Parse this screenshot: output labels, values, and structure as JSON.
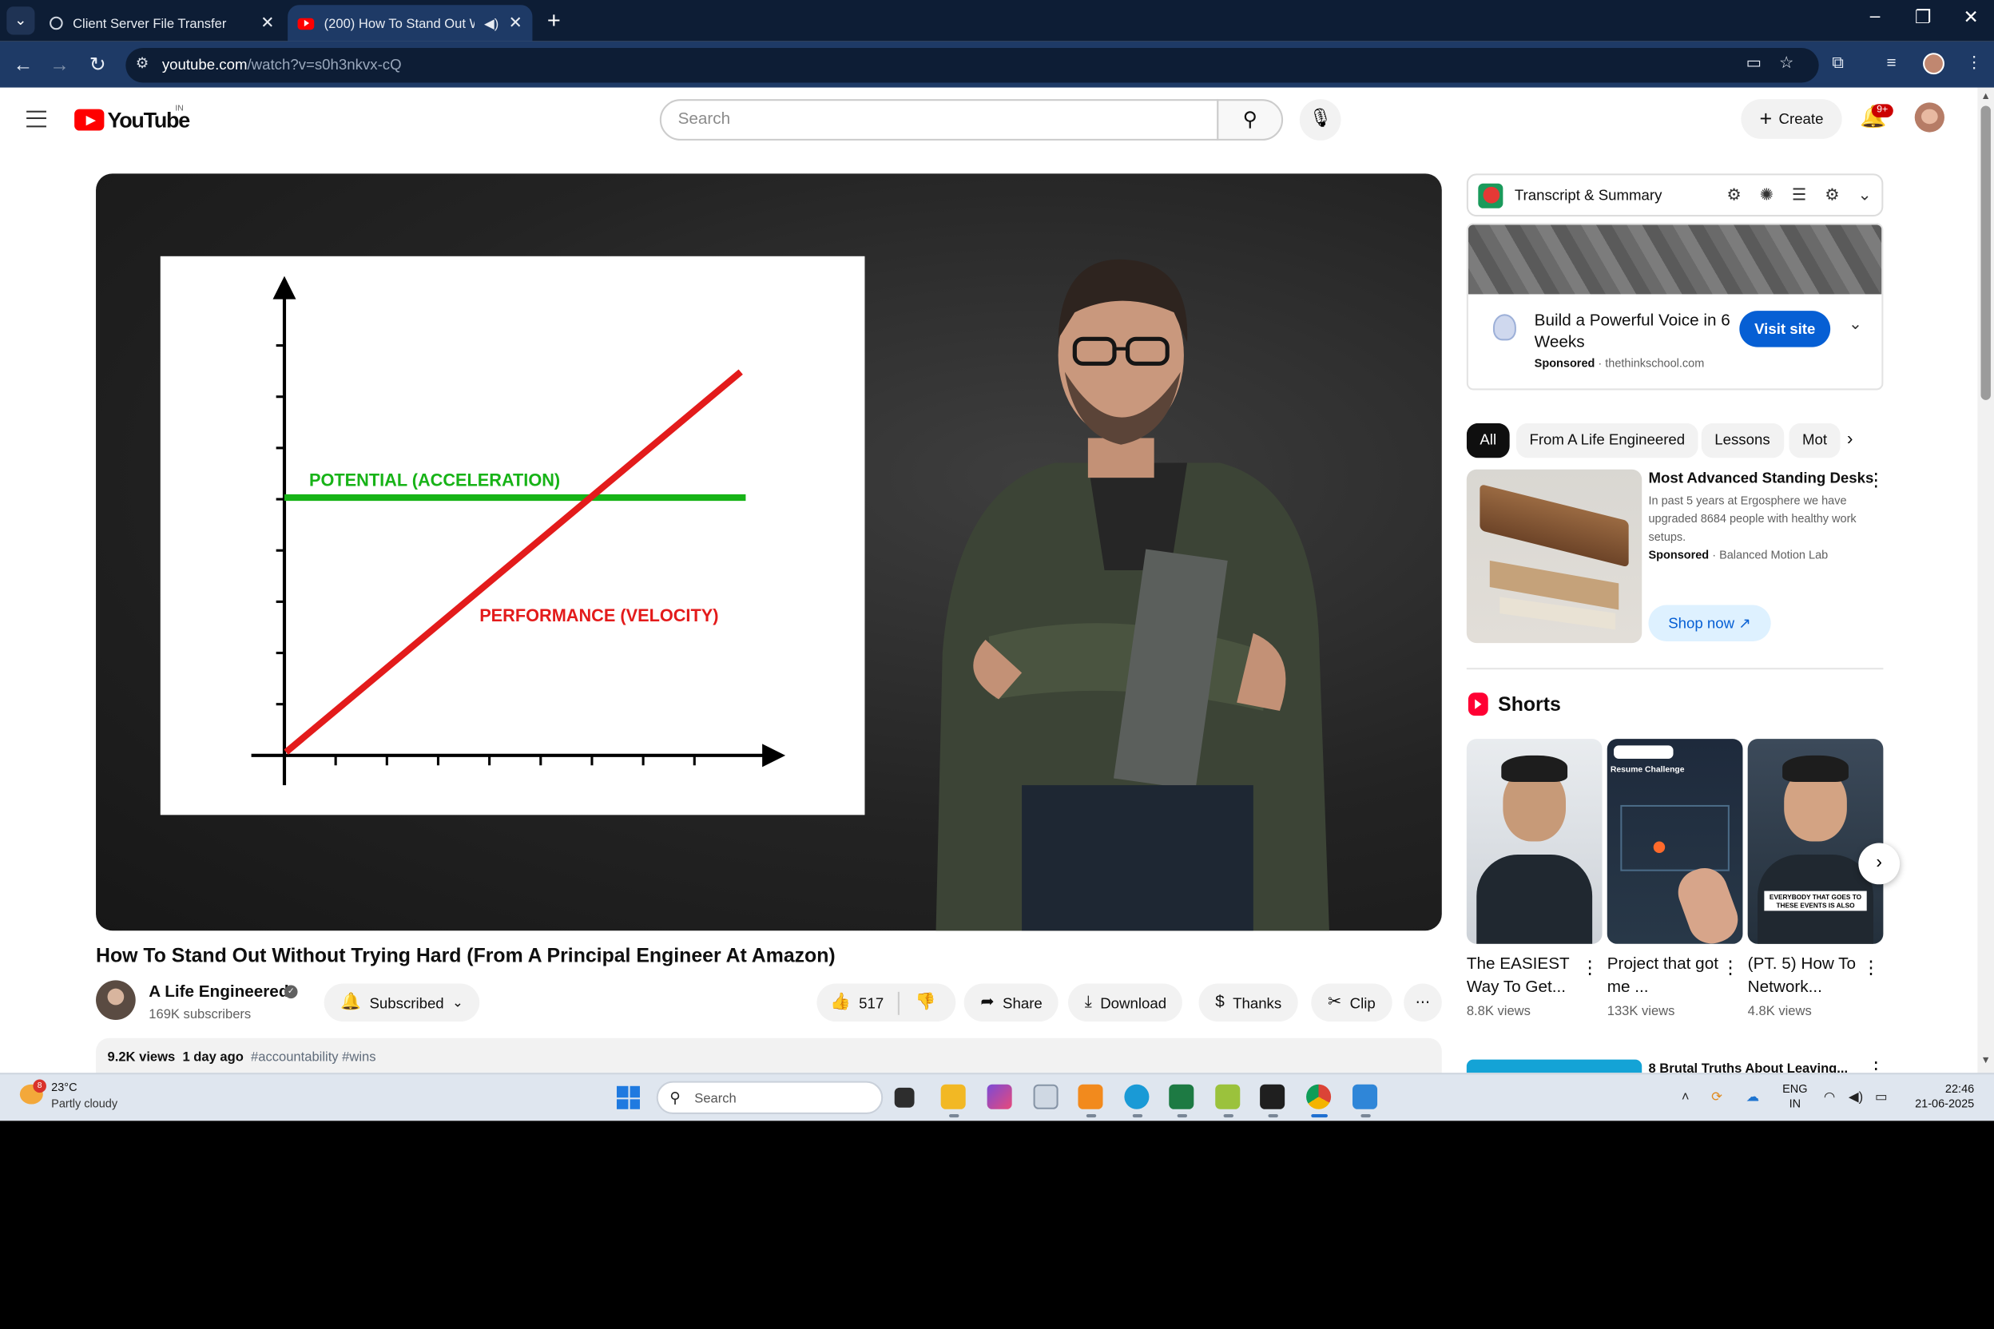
{
  "browser": {
    "tabs": [
      {
        "title": "Client Server File Transfer"
      },
      {
        "title": "(200) How To Stand Out Wi"
      }
    ],
    "url_host": "youtube.com",
    "url_path": "/watch?v=s0h3nkvx-cQ"
  },
  "youtube": {
    "logo_text": "YouTube",
    "region": "IN",
    "search_placeholder": "Search",
    "create_label": "Create",
    "notif_badge": "9+"
  },
  "video": {
    "graph": {
      "line_labels": [
        "POTENTIAL (ACCELERATION)",
        "PERFORMANCE (VELOCITY)"
      ],
      "colors": {
        "potential": "#17b317",
        "performance": "#e31b1b"
      }
    },
    "title": "How To Stand Out Without Trying Hard (From A Principal Engineer At Amazon)",
    "channel": "A Life Engineered",
    "subscribers": "169K subscribers",
    "subscribed_label": "Subscribed",
    "likes": "517",
    "actions": {
      "share": "Share",
      "download": "Download",
      "thanks": "Thanks",
      "clip": "Clip"
    },
    "views": "9.2K views",
    "age": "1 day ago",
    "hashtags": "#accountability #wins"
  },
  "sidebar": {
    "extension_title": "Transcript & Summary",
    "ad1": {
      "headline": "Build a Powerful Voice in 6 Weeks",
      "sponsored": "Sponsored",
      "domain": "thethinkschool.com",
      "cta": "Visit site"
    },
    "chips": [
      "All",
      "From A Life Engineered",
      "Lessons",
      "Mot"
    ],
    "ad2": {
      "title": "Most Advanced Standing Desks",
      "description": "In past 5 years at Ergosphere we have upgraded 8684 people with healthy work setups.",
      "sponsored": "Sponsored",
      "advertiser": "Balanced Motion Lab",
      "cta": "Shop now"
    },
    "shorts_title": "Shorts",
    "shorts": [
      {
        "title": "The EASIEST Way To Get...",
        "views": "8.8K views"
      },
      {
        "title": "Project that got me ...",
        "views": "133K views",
        "caption": "Resume Challenge"
      },
      {
        "title": "(PT. 5) How To Network...",
        "views": "4.8K views",
        "caption": "EVERYBODY THAT GOES TO THESE EVENTS IS ALSO"
      }
    ],
    "next_title": "8 Brutal Truths About Leaving..."
  },
  "taskbar": {
    "weather_badge": "8",
    "temperature": "23°C",
    "weather": "Partly cloudy",
    "search": "Search",
    "lang_top": "ENG",
    "lang_bottom": "IN",
    "time": "22:46",
    "date": "21-06-2025"
  }
}
